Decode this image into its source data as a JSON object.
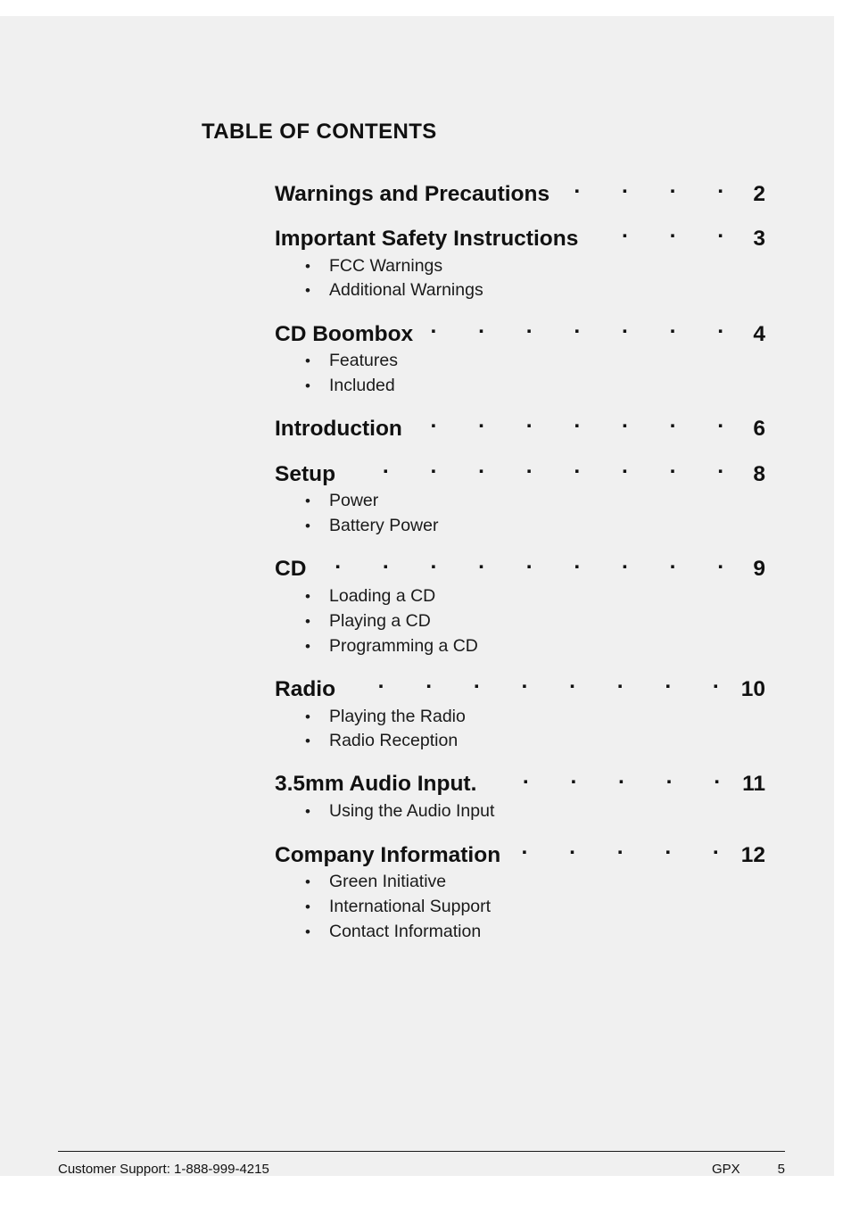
{
  "document": {
    "heading": "TABLE OF CONTENTS",
    "page_background": "#f0f0f0",
    "text_color": "#111111"
  },
  "toc": {
    "sections": [
      {
        "title": "Warnings and Precautions",
        "page": "2",
        "items": []
      },
      {
        "title": "Important Safety Instructions",
        "page": "3",
        "items": [
          {
            "label": "FCC Warnings"
          },
          {
            "label": "Additional Warnings"
          }
        ]
      },
      {
        "title": "CD Boombox",
        "page": "4",
        "items": [
          {
            "label": "Features"
          },
          {
            "label": "Included"
          }
        ]
      },
      {
        "title": "Introduction",
        "page": "6",
        "items": []
      },
      {
        "title": "Setup",
        "page": "8",
        "items": [
          {
            "label": "Power"
          },
          {
            "label": "Battery Power"
          }
        ]
      },
      {
        "title": "CD",
        "page": "9",
        "items": [
          {
            "label": "Loading a CD"
          },
          {
            "label": "Playing a CD"
          },
          {
            "label": "Programming a CD"
          }
        ]
      },
      {
        "title": "Radio",
        "page": "10",
        "items": [
          {
            "label": "Playing the Radio"
          },
          {
            "label": "Radio Reception"
          }
        ]
      },
      {
        "title": "3.5mm Audio Input.",
        "page": "11",
        "items": [
          {
            "label": "Using the Audio Input"
          }
        ]
      },
      {
        "title": "Company Information",
        "page": "12",
        "items": [
          {
            "label": "Green Initiative"
          },
          {
            "label": "International Support"
          },
          {
            "label": "Contact Information"
          }
        ]
      }
    ],
    "bullet_glyph": "•"
  },
  "footer": {
    "customer_support": "Customer Support: 1-888-999-4215",
    "brand": "GPX",
    "page_number": "5"
  }
}
